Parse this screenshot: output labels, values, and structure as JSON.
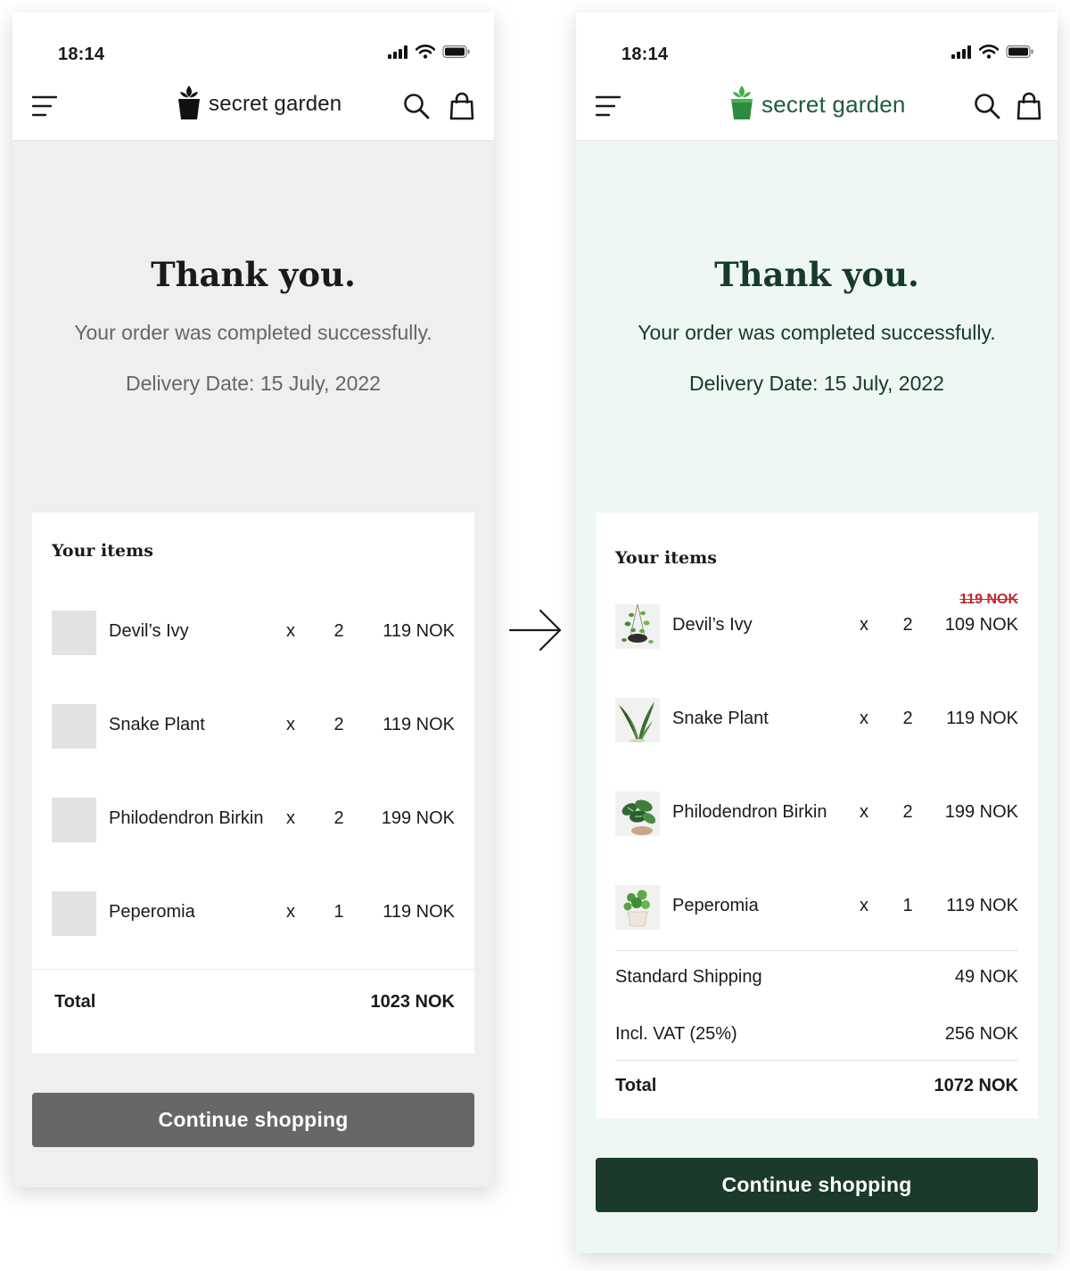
{
  "colors": {
    "left_background": "#efefef",
    "left_button": "#676767",
    "right_background": "#eef7f1",
    "right_button": "#1b3a2c",
    "right_heading": "#163a2c",
    "brand_green": "#2e8b3d",
    "strike_red": "#c0282f"
  },
  "before": {
    "status": {
      "time": "18:14"
    },
    "brand": {
      "name": "secret garden"
    },
    "hero": {
      "title": "Thank you.",
      "subtitle": "Your order was completed successfully.",
      "delivery": "Delivery Date: 15 July, 2022"
    },
    "card": {
      "title": "Your items",
      "items": [
        {
          "name": "Devil’s Ivy",
          "x": "x",
          "qty": "2",
          "price": "119 NOK"
        },
        {
          "name": "Snake Plant",
          "x": "x",
          "qty": "2",
          "price": "119 NOK"
        },
        {
          "name": "Philodendron Birkin",
          "x": "x",
          "qty": "2",
          "price": "199 NOK"
        },
        {
          "name": "Peperomia",
          "x": "x",
          "qty": "1",
          "price": "119 NOK"
        }
      ],
      "total_label": "Total",
      "total_value": "1023 NOK"
    },
    "button": "Continue shopping"
  },
  "after": {
    "status": {
      "time": "18:14"
    },
    "brand": {
      "name": "secret garden"
    },
    "hero": {
      "title": "Thank you.",
      "subtitle": "Your order was completed successfully.",
      "delivery": "Delivery Date: 15 July, 2022"
    },
    "card": {
      "title": "Your items",
      "items": [
        {
          "name": "Devil’s Ivy",
          "x": "x",
          "qty": "2",
          "price": "109 NOK",
          "old_price": "119 NOK",
          "icon": "hanging-plant-icon"
        },
        {
          "name": "Snake Plant",
          "x": "x",
          "qty": "2",
          "price": "119 NOK",
          "icon": "snake-plant-icon"
        },
        {
          "name": "Philodendron Birkin",
          "x": "x",
          "qty": "2",
          "price": "199 NOK",
          "icon": "philodendron-icon"
        },
        {
          "name": "Peperomia",
          "x": "x",
          "qty": "1",
          "price": "119 NOK",
          "icon": "potted-plant-icon"
        }
      ],
      "shipping_label": "Standard Shipping",
      "shipping_value": "49 NOK",
      "vat_label": "Incl. VAT (25%)",
      "vat_value": "256 NOK",
      "total_label": "Total",
      "total_value": "1072 NOK"
    },
    "button": "Continue shopping"
  }
}
